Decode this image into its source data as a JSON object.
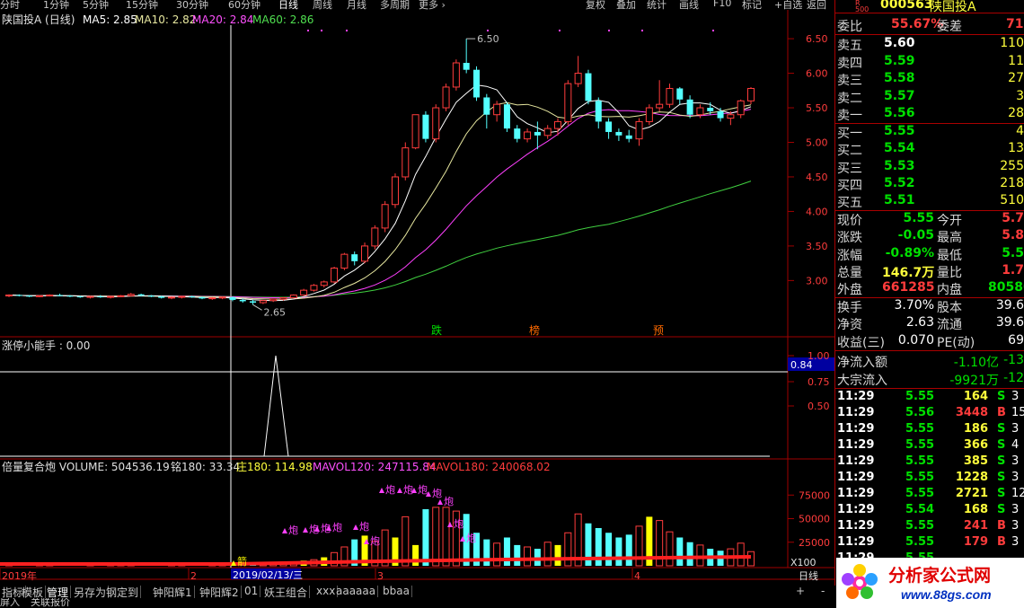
{
  "toolbar": {
    "periods": [
      "分时",
      "1分钟",
      "5分钟",
      "15分钟",
      "30分钟",
      "60分钟",
      "日线",
      "周线",
      "月线",
      "多周期",
      "更多 ›"
    ],
    "active": "日线",
    "right_buttons": [
      "复权",
      "叠加",
      "统计",
      "画线",
      "F10",
      "标记",
      "+自选",
      "返回"
    ]
  },
  "main_panel": {
    "title": "陕国投A (日线)",
    "legend": [
      {
        "label": "MA5: 2.85",
        "color": "#ffffff"
      },
      {
        "label": "MA10: 2.82",
        "color": "#e8e8a0"
      },
      {
        "label": "MA20: 2.84",
        "color": "#ff50ff"
      },
      {
        "label": "MA60: 2.86",
        "color": "#50e050"
      }
    ],
    "high_label": "6.50",
    "low_label": "2.65",
    "markers": [
      {
        "text": "跌",
        "color": "#00e000"
      },
      {
        "text": "榜",
        "color": "#ff6a00"
      },
      {
        "text": "预",
        "color": "#ff6a00"
      }
    ]
  },
  "sub1": {
    "title": "涨停小能手 : 0.00",
    "current_value": "0.84",
    "ticks": [
      "1.00",
      "0.75",
      "0.50"
    ]
  },
  "sub2": {
    "title_parts": [
      {
        "text": "倍量复合炮  VOLUME: 504536.19",
        "color": "#e0e0e0"
      },
      {
        "text": "铭180: 33.34",
        "color": "#e0e0e0"
      },
      {
        "text": "庄180: 114.98",
        "color": "#ffff3c"
      },
      {
        "text": "MAVOL120: 247115.84",
        "color": "#ff50ff"
      },
      {
        "text": "MAVOL180: 240068.02",
        "color": "#ff3c3c"
      }
    ],
    "ticks": [
      "75000",
      "50000",
      "25000"
    ],
    "unit": "X100",
    "signal_jian": "箭",
    "signal_pao": "炮"
  },
  "chart_data": {
    "type": "candlestick",
    "price_axis": {
      "ticks": [
        6.5,
        6.0,
        5.5,
        5.0,
        4.5,
        4.0,
        3.5,
        3.0
      ],
      "range": [
        2.55,
        6.8
      ]
    },
    "x_labels": [
      "2019年",
      "2",
      "3",
      "4"
    ],
    "cursor_date": "2019/02/13/三",
    "period_label": "日线",
    "candles": [
      [
        2.78,
        2.8,
        2.76,
        2.79
      ],
      [
        2.79,
        2.8,
        2.77,
        2.78
      ],
      [
        2.78,
        2.79,
        2.76,
        2.77
      ],
      [
        2.77,
        2.79,
        2.76,
        2.78
      ],
      [
        2.78,
        2.8,
        2.77,
        2.79
      ],
      [
        2.79,
        2.81,
        2.77,
        2.78
      ],
      [
        2.78,
        2.79,
        2.76,
        2.77
      ],
      [
        2.77,
        2.78,
        2.75,
        2.76
      ],
      [
        2.76,
        2.78,
        2.74,
        2.77
      ],
      [
        2.77,
        2.79,
        2.75,
        2.76
      ],
      [
        2.76,
        2.78,
        2.74,
        2.77
      ],
      [
        2.77,
        2.79,
        2.76,
        2.78
      ],
      [
        2.78,
        2.82,
        2.77,
        2.8
      ],
      [
        2.8,
        2.81,
        2.77,
        2.78
      ],
      [
        2.78,
        2.79,
        2.76,
        2.77
      ],
      [
        2.77,
        2.78,
        2.74,
        2.75
      ],
      [
        2.75,
        2.77,
        2.73,
        2.76
      ],
      [
        2.76,
        2.78,
        2.74,
        2.77
      ],
      [
        2.77,
        2.78,
        2.75,
        2.76
      ],
      [
        2.76,
        2.77,
        2.73,
        2.74
      ],
      [
        2.74,
        2.76,
        2.72,
        2.75
      ],
      [
        2.75,
        2.77,
        2.73,
        2.76
      ],
      [
        2.76,
        2.77,
        2.7,
        2.72
      ],
      [
        2.72,
        2.74,
        2.68,
        2.7
      ],
      [
        2.7,
        2.72,
        2.65,
        2.68
      ],
      [
        2.68,
        2.72,
        2.66,
        2.71
      ],
      [
        2.71,
        2.74,
        2.69,
        2.73
      ],
      [
        2.73,
        2.76,
        2.71,
        2.75
      ],
      [
        2.75,
        2.8,
        2.74,
        2.79
      ],
      [
        2.79,
        2.88,
        2.78,
        2.86
      ],
      [
        2.86,
        2.95,
        2.84,
        2.93
      ],
      [
        2.93,
        3.0,
        2.9,
        2.98
      ],
      [
        2.98,
        3.2,
        2.96,
        3.18
      ],
      [
        3.18,
        3.4,
        3.15,
        3.38
      ],
      [
        3.38,
        3.42,
        3.22,
        3.28
      ],
      [
        3.28,
        3.55,
        3.25,
        3.5
      ],
      [
        3.5,
        3.8,
        3.45,
        3.76
      ],
      [
        3.76,
        4.15,
        3.7,
        4.1
      ],
      [
        4.1,
        4.55,
        4.05,
        4.5
      ],
      [
        4.5,
        5.0,
        4.45,
        4.92
      ],
      [
        4.92,
        5.4,
        4.9,
        5.4
      ],
      [
        5.4,
        5.45,
        5.0,
        5.05
      ],
      [
        5.05,
        5.55,
        5.0,
        5.5
      ],
      [
        5.5,
        5.85,
        5.45,
        5.8
      ],
      [
        5.8,
        6.2,
        5.75,
        6.15
      ],
      [
        6.15,
        6.5,
        6.0,
        6.05
      ],
      [
        6.05,
        6.1,
        5.6,
        5.65
      ],
      [
        5.65,
        5.7,
        5.2,
        5.4
      ],
      [
        5.4,
        5.6,
        5.3,
        5.55
      ],
      [
        5.55,
        5.58,
        5.15,
        5.2
      ],
      [
        5.2,
        5.25,
        5.0,
        5.05
      ],
      [
        5.05,
        5.2,
        5.0,
        5.15
      ],
      [
        5.15,
        5.3,
        4.9,
        5.1
      ],
      [
        5.1,
        5.25,
        5.05,
        5.2
      ],
      [
        5.2,
        5.35,
        5.1,
        5.3
      ],
      [
        5.3,
        5.9,
        5.25,
        5.85
      ],
      [
        5.85,
        6.25,
        5.8,
        6.0
      ],
      [
        6.0,
        6.05,
        5.55,
        5.6
      ],
      [
        5.6,
        5.65,
        5.2,
        5.3
      ],
      [
        5.3,
        5.35,
        5.05,
        5.15
      ],
      [
        5.15,
        5.2,
        5.02,
        5.1
      ],
      [
        5.1,
        5.18,
        5.0,
        5.05
      ],
      [
        5.05,
        5.35,
        4.95,
        5.3
      ],
      [
        5.3,
        5.55,
        5.25,
        5.5
      ],
      [
        5.5,
        5.9,
        5.45,
        5.55
      ],
      [
        5.55,
        5.85,
        5.5,
        5.78
      ],
      [
        5.78,
        5.8,
        5.55,
        5.62
      ],
      [
        5.62,
        5.68,
        5.35,
        5.4
      ],
      [
        5.4,
        5.55,
        5.35,
        5.5
      ],
      [
        5.5,
        5.58,
        5.4,
        5.45
      ],
      [
        5.45,
        5.5,
        5.3,
        5.35
      ],
      [
        5.35,
        5.45,
        5.25,
        5.4
      ],
      [
        5.4,
        5.62,
        5.35,
        5.6
      ],
      [
        5.6,
        5.8,
        5.55,
        5.78
      ]
    ],
    "volume_axis": {
      "ticks": [
        75000,
        50000,
        25000
      ],
      "range": [
        0,
        100000
      ]
    },
    "volumes": [
      1800,
      1500,
      1600,
      1700,
      2000,
      1900,
      1500,
      1400,
      1700,
      1600,
      1500,
      1800,
      2500,
      2100,
      1700,
      1500,
      1600,
      1800,
      1700,
      1400,
      1600,
      1700,
      1800,
      2000,
      2600,
      2400,
      2600,
      3000,
      4000,
      5500,
      6500,
      9000,
      14000,
      20000,
      28000,
      32000,
      26000,
      38000,
      30000,
      52000,
      22000,
      60000,
      62000,
      62000,
      58000,
      55000,
      35000,
      28000,
      24000,
      30000,
      22000,
      20000,
      18000,
      25000,
      22000,
      35000,
      55000,
      45000,
      40000,
      35000,
      30000,
      33000,
      42000,
      52000,
      48000,
      36000,
      30000,
      25000,
      22000,
      18000,
      16000,
      18000,
      24000,
      15000
    ]
  },
  "quote": {
    "badge": "R\n500",
    "code": "000563",
    "name": "陕国投A",
    "weibi_label": "委比",
    "weibi": "55.67%",
    "weicha_label": "委差",
    "weicha": "715",
    "sells": [
      {
        "label": "卖五",
        "price": "5.60",
        "vol": "110"
      },
      {
        "label": "卖四",
        "price": "5.59",
        "vol": "11"
      },
      {
        "label": "卖三",
        "price": "5.58",
        "vol": "27"
      },
      {
        "label": "卖二",
        "price": "5.57",
        "vol": "3"
      },
      {
        "label": "卖一",
        "price": "5.56",
        "vol": "28"
      }
    ],
    "buys": [
      {
        "label": "买一",
        "price": "5.55",
        "vol": "4"
      },
      {
        "label": "买二",
        "price": "5.54",
        "vol": "13"
      },
      {
        "label": "买三",
        "price": "5.53",
        "vol": "255"
      },
      {
        "label": "买四",
        "price": "5.52",
        "vol": "218"
      },
      {
        "label": "买五",
        "price": "5.51",
        "vol": "510"
      }
    ],
    "stats": [
      {
        "l1": "现价",
        "v1": "5.55",
        "c1": "grn",
        "l2": "今开",
        "v2": "5.7",
        "c2": "red"
      },
      {
        "l1": "涨跌",
        "v1": "-0.05",
        "c1": "grn",
        "l2": "最高",
        "v2": "5.8",
        "c2": "red"
      },
      {
        "l1": "涨幅",
        "v1": "-0.89%",
        "c1": "grn",
        "l2": "最低",
        "v2": "5.5",
        "c2": "grn"
      },
      {
        "l1": "总量",
        "v1": "146.7万",
        "c1": "yel",
        "l2": "量比",
        "v2": "1.7",
        "c2": "red"
      },
      {
        "l1": "外盘",
        "v1": "661285",
        "c1": "red",
        "l2": "内盘",
        "v2": "80580",
        "c2": "grn"
      }
    ],
    "stats2": [
      {
        "l1": "换手",
        "v1": "3.70%",
        "l2": "股本",
        "v2": "39.6"
      },
      {
        "l1": "净资",
        "v1": "2.63",
        "l2": "流通",
        "v2": "39.6"
      },
      {
        "l1": "收益(三)",
        "v1": "0.070",
        "l2": "PE(动)",
        "v2": "69"
      }
    ],
    "flow": [
      {
        "label": "净流入额",
        "v1": "-1.10亿",
        "v2": "-13"
      },
      {
        "label": "大宗流入",
        "v1": "-9921万",
        "v2": "-12"
      }
    ],
    "ticks": [
      {
        "t": "11:29",
        "p": "5.55",
        "v": "164",
        "bs": "S",
        "x": "3"
      },
      {
        "t": "11:29",
        "p": "5.56",
        "v": "3448",
        "bs": "B",
        "x": "15"
      },
      {
        "t": "11:29",
        "p": "5.55",
        "v": "186",
        "bs": "S",
        "x": "3"
      },
      {
        "t": "11:29",
        "p": "5.55",
        "v": "366",
        "bs": "S",
        "x": "4"
      },
      {
        "t": "11:29",
        "p": "5.55",
        "v": "385",
        "bs": "S",
        "x": "3"
      },
      {
        "t": "11:29",
        "p": "5.55",
        "v": "1228",
        "bs": "S",
        "x": "3"
      },
      {
        "t": "11:29",
        "p": "5.55",
        "v": "2721",
        "bs": "S",
        "x": "12"
      },
      {
        "t": "11:29",
        "p": "5.54",
        "v": "168",
        "bs": "S",
        "x": "3"
      },
      {
        "t": "11:29",
        "p": "5.55",
        "v": "241",
        "bs": "B",
        "x": "3"
      },
      {
        "t": "11:29",
        "p": "5.55",
        "v": "179",
        "bs": "B",
        "x": "3"
      },
      {
        "t": "11:29",
        "p": "5.55",
        "v": "",
        "bs": "",
        "x": ""
      }
    ]
  },
  "tabs": [
    "指标",
    "模板",
    "管理",
    "另存为",
    "钢定到",
    "钟阳辉1",
    "钟阳辉2",
    "01",
    "妖王组合",
    "xxx",
    "aaaaaa",
    "bbaa"
  ],
  "bottom_items": [
    "屏入",
    "关联报价"
  ],
  "footer_controls": {
    "plus": "+",
    "minus": "-"
  },
  "logo": {
    "title": "分析家公式网",
    "url": "www.88gs.com"
  }
}
